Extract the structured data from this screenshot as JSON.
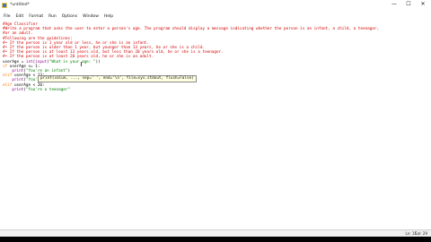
{
  "window": {
    "title": "*untitled*",
    "controls": {
      "minimize": "—",
      "maximize": "☐",
      "close": "✕"
    }
  },
  "menu": [
    "File",
    "Edit",
    "Format",
    "Run",
    "Options",
    "Window",
    "Help"
  ],
  "code_lines": [
    [
      {
        "c": "cm",
        "t": "#Age Classifier"
      }
    ],
    [
      {
        "c": "cm",
        "t": "#Write a program that asks the user to enter a person's age. The program should display a message indicating whether the person is an infant, a child, a teenager,"
      }
    ],
    [
      {
        "c": "cm",
        "t": "#or an adult."
      }
    ],
    [
      {
        "c": "cm",
        "t": "#Following are the guidelines:"
      }
    ],
    [
      {
        "c": "cm",
        "t": "#• If the person is 1 year old or less, he or she is an infant."
      }
    ],
    [
      {
        "c": "cm",
        "t": "#• If the person is older than 1 year, but younger than 13 years, he or she is a child."
      }
    ],
    [
      {
        "c": "cm",
        "t": "#• If the person is at least 13 years old, but less than 20 years old, he or she is a teenager."
      }
    ],
    [
      {
        "c": "cm",
        "t": "#• If the person is at least 20 years old, he or she is an adult."
      }
    ],
    [
      {
        "c": "df",
        "t": "userAge = "
      },
      {
        "c": "bi",
        "t": "int"
      },
      {
        "c": "df",
        "t": "("
      },
      {
        "c": "bi",
        "t": "input"
      },
      {
        "c": "df",
        "t": "("
      },
      {
        "c": "st",
        "t": "\"What is your age: \""
      },
      {
        "c": "df",
        "t": "))"
      }
    ],
    [
      {
        "c": "kw",
        "t": "if"
      },
      {
        "c": "df",
        "t": " userAge <= 1:"
      }
    ],
    [
      {
        "c": "df",
        "t": "    "
      },
      {
        "c": "bi",
        "t": "print"
      },
      {
        "c": "df",
        "t": "("
      },
      {
        "c": "st",
        "t": "\"You're an infant\""
      },
      {
        "c": "df",
        "t": ")"
      }
    ],
    [
      {
        "c": "kw",
        "t": "elif"
      },
      {
        "c": "df",
        "t": " userAge < 13:"
      }
    ],
    [
      {
        "c": "df",
        "t": "    "
      },
      {
        "c": "bi",
        "t": "print"
      },
      {
        "c": "df",
        "t": "("
      },
      {
        "c": "st",
        "t": "\"You're a child\""
      },
      {
        "c": "df",
        "t": ")"
      }
    ],
    [
      {
        "c": "kw",
        "t": "elif"
      },
      {
        "c": "df",
        "t": " userAge < 20:"
      }
    ],
    [
      {
        "c": "df",
        "t": "    "
      },
      {
        "c": "bi",
        "t": "print"
      },
      {
        "c": "df",
        "t": "("
      },
      {
        "c": "st",
        "t": "\"You're a teenager\""
      }
    ]
  ],
  "calltip": "print(value, ..., sep=' ', end='\\n', file=sys.stdout, flush=False)",
  "status": {
    "line": "Ln: 15",
    "col": "Col: 29"
  },
  "colors": {
    "comment": "#d40000",
    "keyword": "#ff7700",
    "string": "#008000",
    "builtin": "#900090"
  }
}
